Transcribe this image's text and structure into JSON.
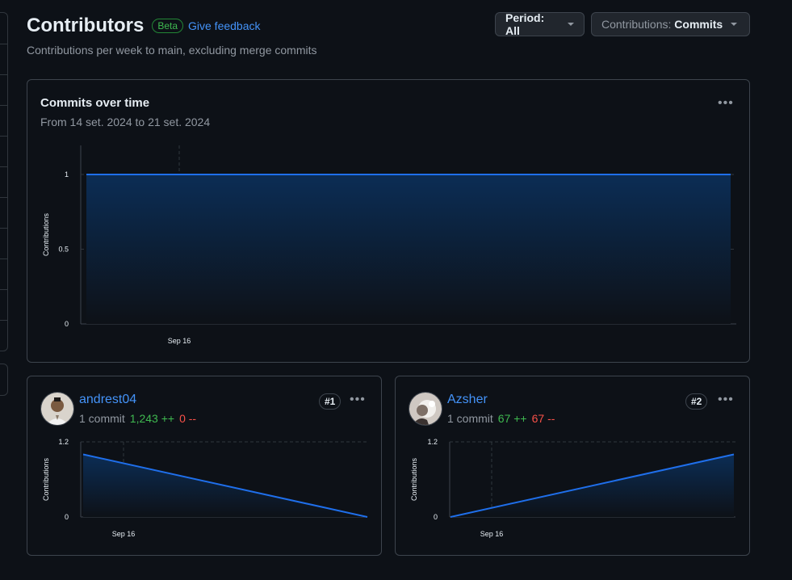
{
  "header": {
    "title": "Contributors",
    "badge": "Beta",
    "feedback": "Give feedback",
    "subtitle": "Contributions per week to main, excluding merge commits"
  },
  "filters": {
    "period_label": "Period: All",
    "contrib_prefix": "Contributions:",
    "contrib_value": "Commits"
  },
  "main_chart": {
    "title": "Commits over time",
    "range": "From 14 set. 2024 to 21 set. 2024"
  },
  "contributors": [
    {
      "name": "andrest04",
      "commits": "1 commit",
      "additions": "1,243 ++",
      "deletions": "0 --",
      "rank": "#1"
    },
    {
      "name": "Azsher",
      "commits": "1 commit",
      "additions": "67 ++",
      "deletions": "67 --",
      "rank": "#2"
    }
  ],
  "colors": {
    "accent": "#4493f8",
    "line": "#1f6feb",
    "add": "#3fb950",
    "del": "#f85149"
  },
  "chart_data": [
    {
      "type": "area",
      "title": "Commits over time",
      "ylabel": "Contributions",
      "x_ticks": [
        "Sep 16"
      ],
      "y_ticks": [
        "0",
        "0.5",
        "1"
      ],
      "ylim": [
        0,
        1
      ],
      "x": [
        "14 set. 2024",
        "21 set. 2024"
      ],
      "values": [
        1,
        1
      ],
      "grid": true
    },
    {
      "type": "area",
      "series_name": "andrest04",
      "ylabel": "Contributions",
      "x_ticks": [
        "Sep 16"
      ],
      "y_ticks": [
        "0",
        "1.2"
      ],
      "ylim": [
        0,
        1.2
      ],
      "x": [
        "14 set. 2024",
        "21 set. 2024"
      ],
      "values": [
        1,
        0
      ]
    },
    {
      "type": "area",
      "series_name": "Azsher",
      "ylabel": "Contributions",
      "x_ticks": [
        "Sep 16"
      ],
      "y_ticks": [
        "0",
        "1.2"
      ],
      "ylim": [
        0,
        1.2
      ],
      "x": [
        "14 set. 2024",
        "21 set. 2024"
      ],
      "values": [
        0,
        1
      ]
    }
  ]
}
